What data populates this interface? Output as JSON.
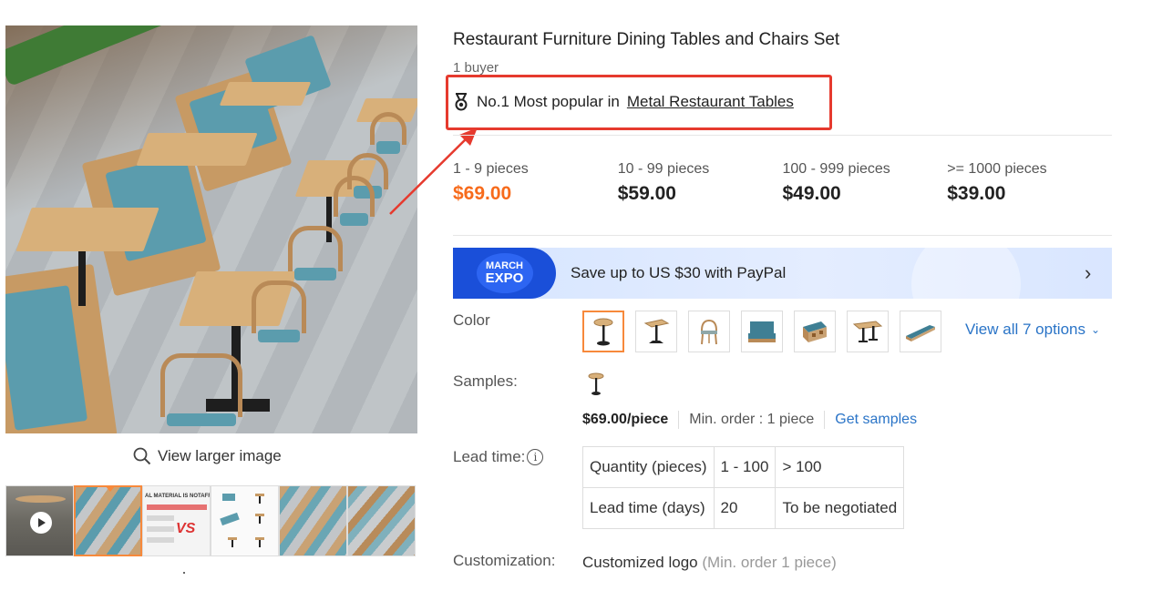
{
  "gallery": {
    "view_larger_label": "View larger image",
    "thumbnail_count": 6,
    "active_thumbnail": 2
  },
  "product": {
    "title": "Restaurant Furniture Dining Tables and Chairs Set",
    "buyers": "1 buyer",
    "rank_prefix": "No.1 Most popular in",
    "rank_category": "Metal Restaurant Tables"
  },
  "pricing": {
    "tiers": [
      {
        "range": "1 - 9 pieces",
        "price": "$69.00"
      },
      {
        "range": "10 - 99 pieces",
        "price": "$59.00"
      },
      {
        "range": ">= 1000 pieces",
        "price": "$39.00"
      },
      {
        "range": "100 - 999 pieces",
        "price": "$49.00"
      }
    ],
    "highlight_color": "#f76b1c"
  },
  "promo": {
    "badge_top": "MARCH",
    "badge_bottom": "EXPO",
    "text": "Save up to US $30 with PayPal"
  },
  "color": {
    "label": "Color",
    "view_all": "View all 7 options",
    "options": [
      "round-table-icon",
      "square-table-icon",
      "chair-icon",
      "booth-sofa-icon",
      "storage-booth-icon",
      "long-table-icon",
      "bench-icon"
    ],
    "selected_index": 0
  },
  "samples": {
    "label": "Samples:",
    "price": "$69.00/piece",
    "min_order": "Min. order : 1 piece",
    "link": "Get samples"
  },
  "lead_time": {
    "label": "Lead time:",
    "rows": [
      {
        "head": "Quantity (pieces)",
        "c1": "1 - 100",
        "c2": "> 100"
      },
      {
        "head": "Lead time (days)",
        "c1": "20",
        "c2": "To be negotiated"
      }
    ]
  },
  "customization": {
    "label": "Customization:",
    "value": "Customized logo",
    "note": "(Min. order 1 piece)"
  },
  "colors": {
    "accent_orange": "#f7893b",
    "link_blue": "#2a74c7",
    "annotation_red": "#e63a2e"
  }
}
